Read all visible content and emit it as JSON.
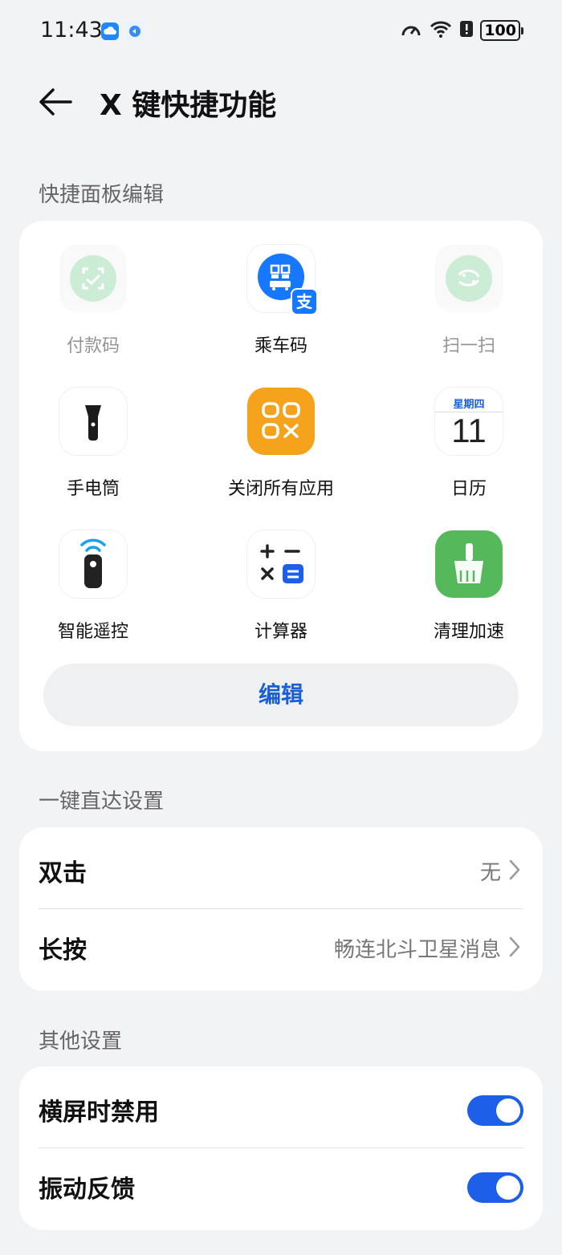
{
  "status_bar": {
    "time": "11:43",
    "battery": "100"
  },
  "header": {
    "title": "X 键快捷功能"
  },
  "shortcut_panel": {
    "section_title": "快捷面板编辑",
    "items": [
      {
        "label": "付款码",
        "icon": "payment-code-icon",
        "enabled": false
      },
      {
        "label": "乘车码",
        "icon": "bus-code-icon",
        "enabled": true
      },
      {
        "label": "扫一扫",
        "icon": "scan-icon",
        "enabled": false
      },
      {
        "label": "手电筒",
        "icon": "flashlight-icon",
        "enabled": true
      },
      {
        "label": "关闭所有应用",
        "icon": "close-all-apps-icon",
        "enabled": true
      },
      {
        "label": "日历",
        "icon": "calendar-icon",
        "enabled": true
      },
      {
        "label": "智能遥控",
        "icon": "remote-control-icon",
        "enabled": true
      },
      {
        "label": "计算器",
        "icon": "calculator-icon",
        "enabled": true
      },
      {
        "label": "清理加速",
        "icon": "cleanup-icon",
        "enabled": true
      }
    ],
    "calendar_weekday": "星期四",
    "calendar_day": "11",
    "alipay_badge": "支",
    "edit_label": "编辑"
  },
  "direct_access": {
    "section_title": "一键直达设置",
    "rows": [
      {
        "label": "双击",
        "value": "无"
      },
      {
        "label": "长按",
        "value": "畅连北斗卫星消息"
      }
    ]
  },
  "other_settings": {
    "section_title": "其他设置",
    "rows": [
      {
        "label": "横屏时禁用",
        "on": true
      },
      {
        "label": "振动反馈",
        "on": true
      }
    ]
  },
  "colors": {
    "accent": "#1d5fe8",
    "edit_text": "#1a5fd6",
    "cleanup_green": "#55b85a",
    "close_all_orange": "#f5a21c"
  }
}
